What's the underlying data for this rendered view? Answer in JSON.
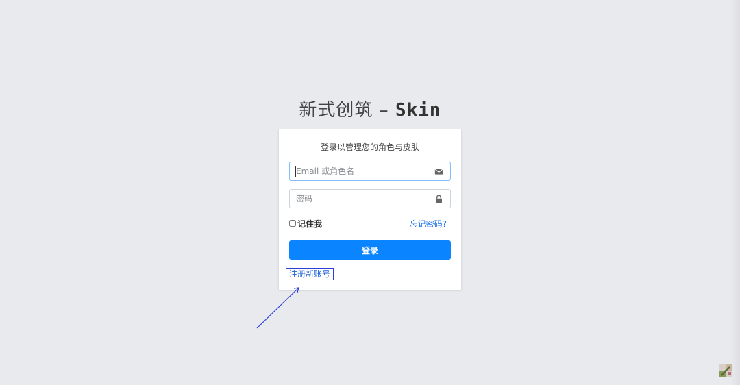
{
  "app": {
    "title_main": "新式创筑",
    "title_sep": " – ",
    "title_suffix": "Skin"
  },
  "login_card": {
    "subtitle": "登录以管理您的角色与皮肤",
    "email_placeholder": "Email 或角色名",
    "email_value": "",
    "password_placeholder": "密码",
    "password_value": "",
    "remember_label": "记住我",
    "forgot_label": "忘记密码?",
    "submit_label": "登录",
    "register_label": "注册新账号"
  },
  "icons": {
    "email": "envelope-icon",
    "password": "lock-icon",
    "corner": "app-logo-icon"
  },
  "colors": {
    "background": "#e8eaed",
    "primary": "#0a84ff",
    "link": "#1a73e8",
    "annotation": "#2b3fd8"
  }
}
